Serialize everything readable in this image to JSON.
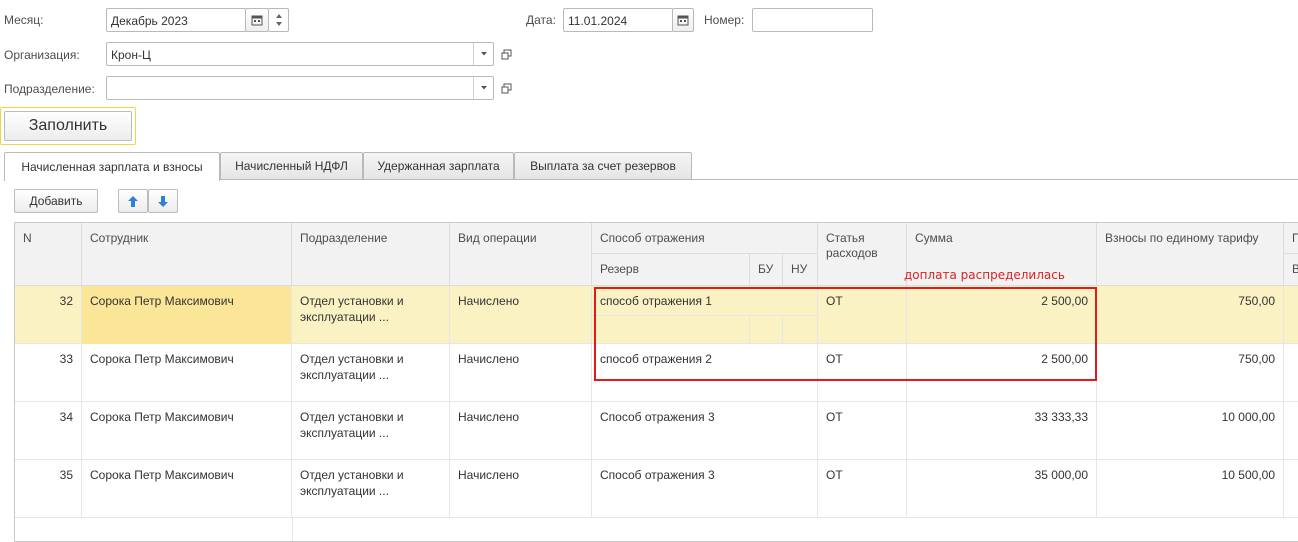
{
  "header": {
    "month_label": "Месяц:",
    "month_value": "Декабрь 2023",
    "date_label": "Дата:",
    "date_value": "11.01.2024",
    "number_label": "Номер:",
    "number_value": "",
    "org_label": "Организация:",
    "org_value": "Крон-Ц",
    "division_label": "Подразделение:",
    "division_value": ""
  },
  "fill_button": "Заполнить",
  "tabs": [
    {
      "label": "Начисленная зарплата и взносы",
      "active": true
    },
    {
      "label": "Начисленный НДФЛ",
      "active": false
    },
    {
      "label": "Удержанная зарплата",
      "active": false
    },
    {
      "label": "Выплата за счет резервов",
      "active": false
    }
  ],
  "toolbar": {
    "add_label": "Добавить"
  },
  "columns": {
    "n": "N",
    "employee": "Сотрудник",
    "division": "Подразделение",
    "operation": "Вид операции",
    "reflection": "Способ отражения",
    "reserve": "Резерв",
    "bu": "БУ",
    "nu": "НУ",
    "expense_item": "Статья расходов",
    "amount": "Сумма",
    "contributions": "Взносы по единому тарифу",
    "cut_top": "П",
    "cut_bottom": "В"
  },
  "rows": [
    {
      "n": "32",
      "employee": "Сорока Петр Максимович",
      "division": "Отдел установки и эксплуатации ...",
      "operation": "Начислено",
      "reflection": "способ отражения 1",
      "expense_item": "ОТ",
      "amount": "2 500,00",
      "contributions": "750,00",
      "selected": true
    },
    {
      "n": "33",
      "employee": "Сорока Петр Максимович",
      "division": "Отдел установки и эксплуатации ...",
      "operation": "Начислено",
      "reflection": "способ отражения 2",
      "expense_item": "ОТ",
      "amount": "2 500,00",
      "contributions": "750,00",
      "selected": false
    },
    {
      "n": "34",
      "employee": "Сорока Петр Максимович",
      "division": "Отдел установки и эксплуатации ...",
      "operation": "Начислено",
      "reflection": "Способ отражения 3",
      "expense_item": "ОТ",
      "amount": "33 333,33",
      "contributions": "10 000,00",
      "selected": false
    },
    {
      "n": "35",
      "employee": "Сорока Петр Максимович",
      "division": "Отдел установки и эксплуатации ...",
      "operation": "Начислено",
      "reflection": "Способ отражения 3",
      "expense_item": "ОТ",
      "amount": "35 000,00",
      "contributions": "10 500,00",
      "selected": false
    }
  ],
  "annotation": "доплата распределилась",
  "colors": {
    "selected_row": "#fbf2c4",
    "current_cell": "#fbe596",
    "annotation": "#e21a1a",
    "fill_border": "#f0d54c"
  }
}
